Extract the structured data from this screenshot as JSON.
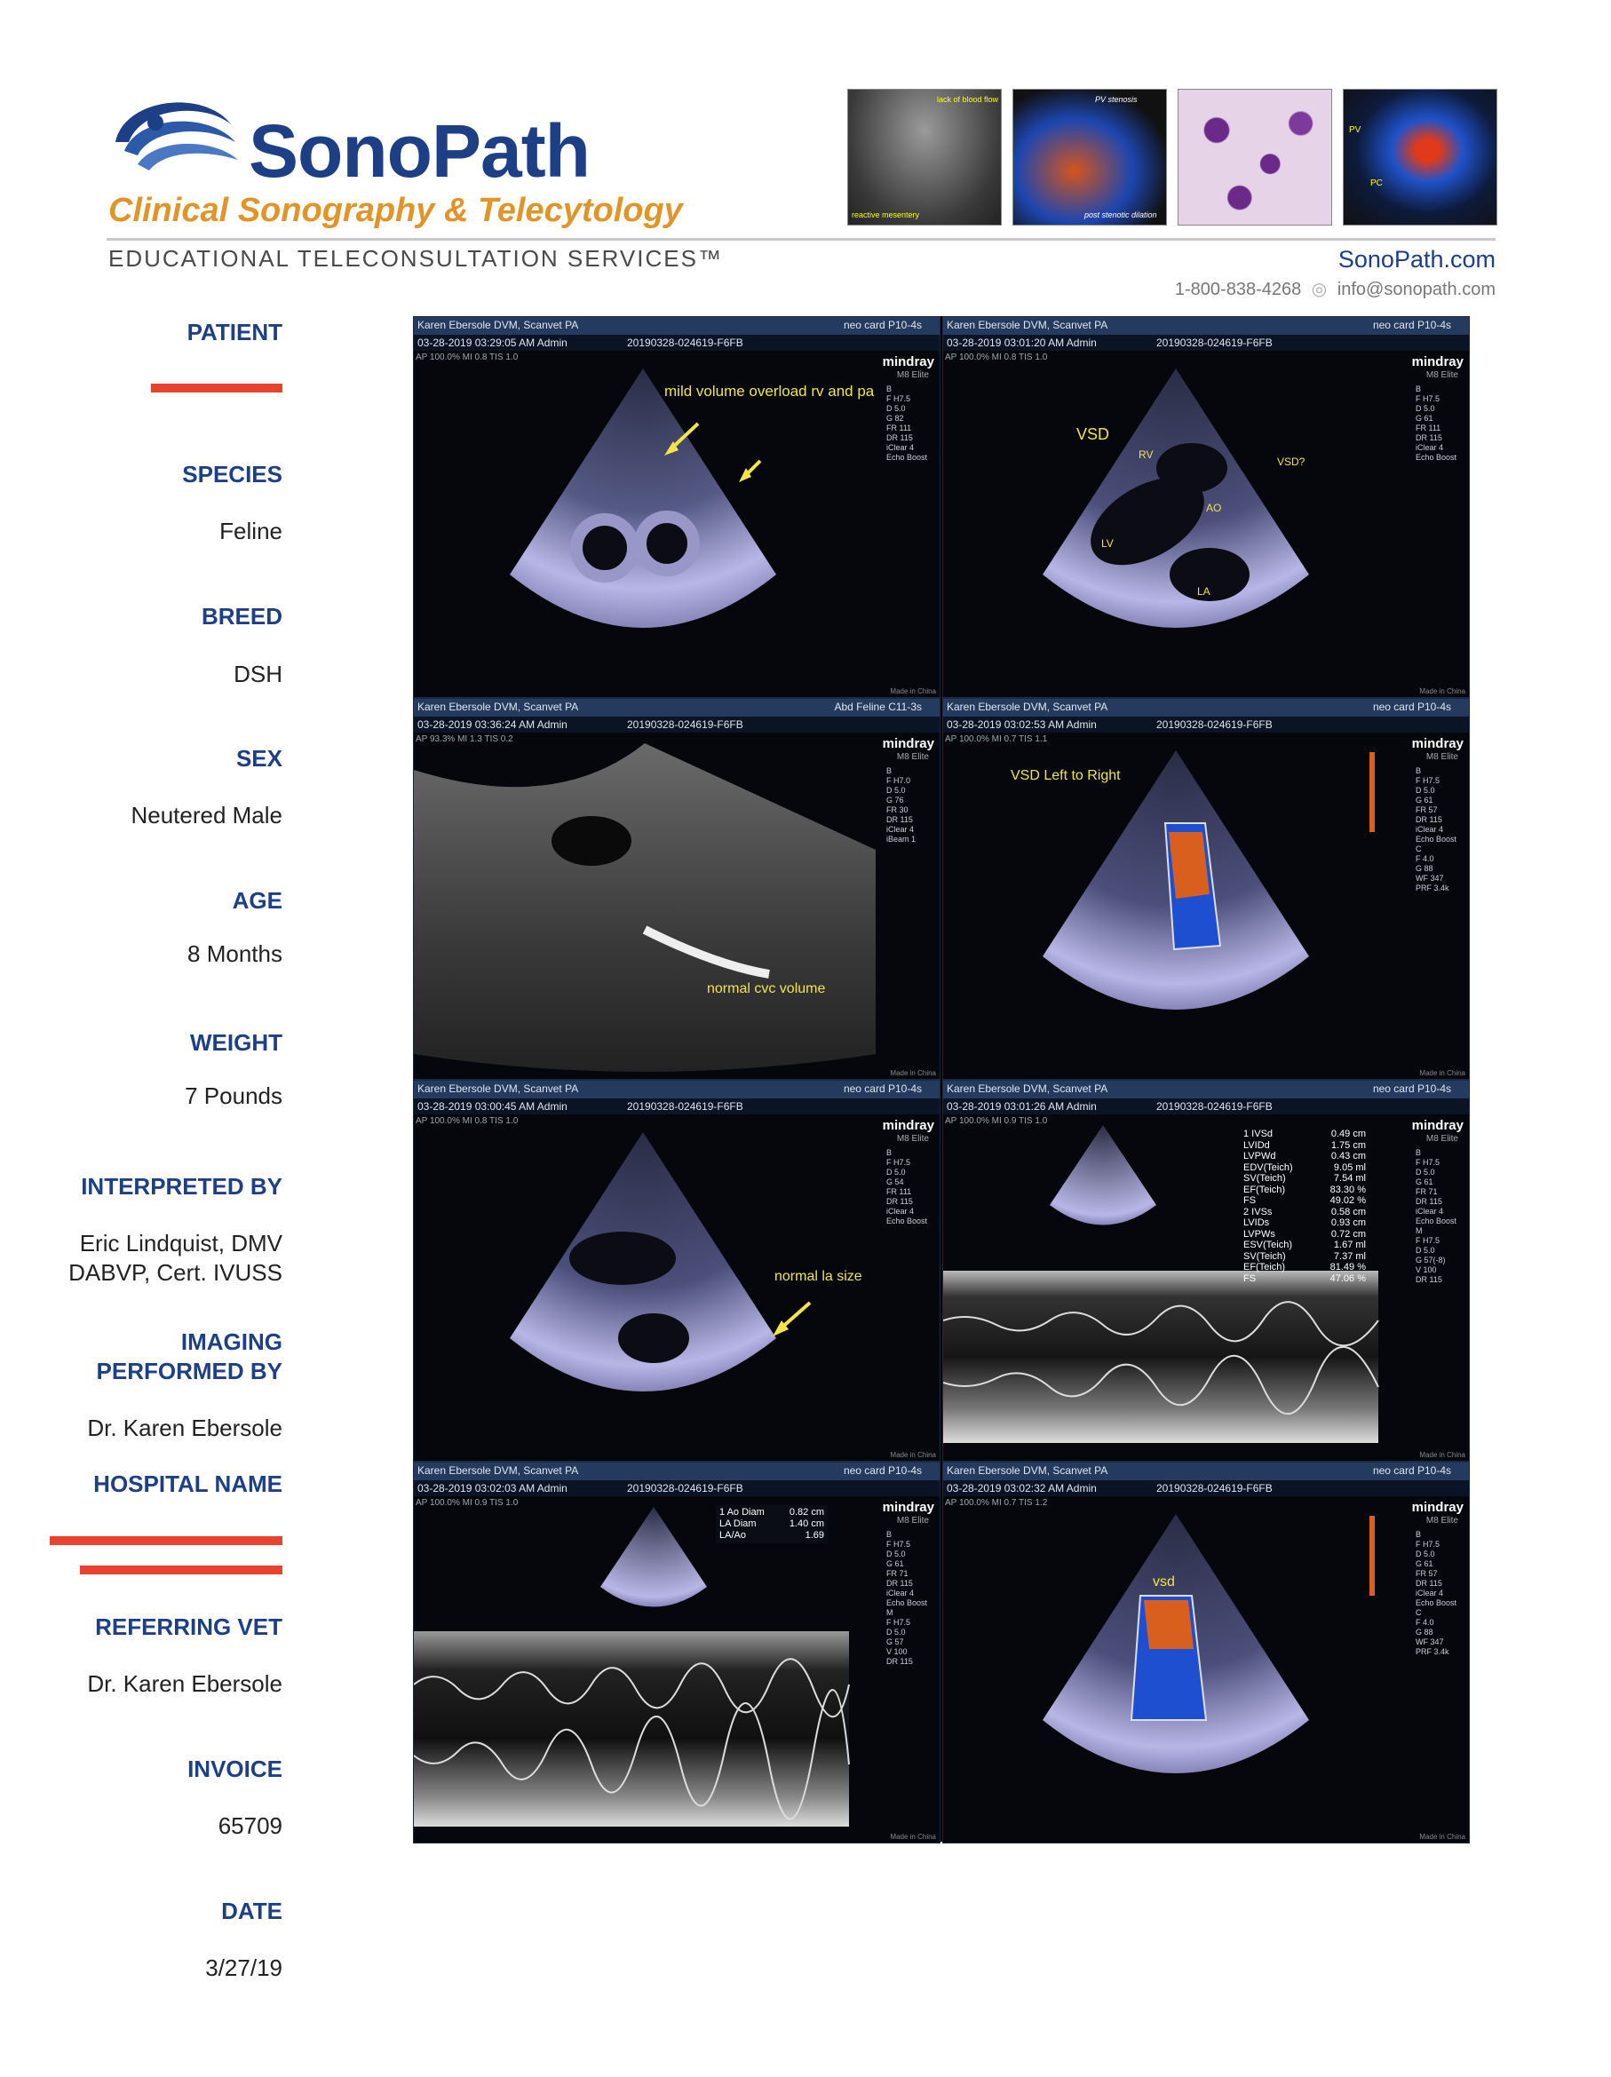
{
  "header": {
    "brand": "SonoPath",
    "tagline": "Clinical Sonography & Telecytology",
    "subtitle": "EDUCATIONAL TELECONSULTATION SERVICES™",
    "website": "SonoPath.com",
    "phone": "1-800-838-4268",
    "email": "info@sonopath.com",
    "thumb_labels": [
      "lack of blood flow",
      "reactive mesentery",
      "PV stenosis",
      "post stenotic dilation",
      "PV",
      "PC"
    ]
  },
  "fields": [
    {
      "label": "PATIENT",
      "value": "",
      "redacted": true
    },
    {
      "label": "SPECIES",
      "value": "Feline"
    },
    {
      "label": "BREED",
      "value": "DSH"
    },
    {
      "label": "SEX",
      "value": "Neutered Male"
    },
    {
      "label": "AGE",
      "value": "8 Months"
    },
    {
      "label": "WEIGHT",
      "value": "7 Pounds"
    },
    {
      "label": "INTERPRETED BY",
      "value": "Eric Lindquist, DMV",
      "value2": "DABVP, Cert. IVUSS"
    },
    {
      "label": "IMAGING",
      "label2": "PERFORMED BY",
      "value": "Dr. Karen Ebersole"
    },
    {
      "label": "HOSPITAL NAME",
      "value": "",
      "redacted": true
    },
    {
      "label": "REFERRING VET",
      "value": "Dr. Karen Ebersole"
    },
    {
      "label": "INVOICE",
      "value": "65709"
    },
    {
      "label": "DATE",
      "value": "3/27/19"
    }
  ],
  "panels": [
    {
      "clinic": "Karen Ebersole DVM, Scanvet PA",
      "datetime": "03-28-2019 03:29:05 AM Admin",
      "study_id": "20190328-024619-F6FB",
      "probe": "neo card P10-4s",
      "ap": "AP 100.0%  MI 0.8  TIS 1.0",
      "brand": "mindray",
      "model": "M8 Elite",
      "params": [
        "B",
        "F H7.5",
        "D 5.0",
        "G 82",
        "FR 111",
        "DR 115",
        "iClear 4",
        "Echo Boost"
      ],
      "annotations": [
        "mild volume overload rv and pa"
      ]
    },
    {
      "clinic": "Karen Ebersole DVM, Scanvet PA",
      "datetime": "03-28-2019 03:01:20 AM Admin",
      "study_id": "20190328-024619-F6FB",
      "probe": "neo card P10-4s",
      "ap": "AP 100.0%  MI 0.8  TIS 1.0",
      "brand": "mindray",
      "model": "M8 Elite",
      "params": [
        "B",
        "F H7.5",
        "D 5.0",
        "G 61",
        "FR 111",
        "DR 115",
        "iClear 4",
        "Echo Boost"
      ],
      "annotations": [
        "VSD",
        "RV",
        "VSD?",
        "AO",
        "LV",
        "LA"
      ]
    },
    {
      "clinic": "Karen Ebersole DVM, Scanvet PA",
      "datetime": "03-28-2019 03:36:24 AM Admin",
      "study_id": "20190328-024619-F6FB",
      "probe": "Abd Feline C11-3s",
      "ap": "AP 93.3%  MI 1.3  TIS 0.2",
      "brand": "mindray",
      "model": "M8 Elite",
      "params": [
        "B",
        "F H7.0",
        "D 5.0",
        "G 76",
        "FR 30",
        "DR 115",
        "iClear 4",
        "iBeam 1"
      ],
      "annotations": [
        "normal cvc volume"
      ]
    },
    {
      "clinic": "Karen Ebersole DVM, Scanvet PA",
      "datetime": "03-28-2019 03:02:53 AM Admin",
      "study_id": "20190328-024619-F6FB",
      "probe": "neo card P10-4s",
      "ap": "AP 100.0%  MI 0.7  TIS 1.1",
      "brand": "mindray",
      "model": "M8 Elite",
      "params": [
        "B",
        "F H7.5",
        "D 5.0",
        "G 61",
        "FR 57",
        "DR 115",
        "iClear 4",
        "Echo Boost",
        "C",
        "F 4.0",
        "G 88",
        "WF 347",
        "PRF 3.4k"
      ],
      "annotations": [
        "VSD Left to Right"
      ]
    },
    {
      "clinic": "Karen Ebersole DVM, Scanvet PA",
      "datetime": "03-28-2019 03:00:45 AM Admin",
      "study_id": "20190328-024619-F6FB",
      "probe": "neo card P10-4s",
      "ap": "AP 100.0%  MI 0.8  TIS 1.0",
      "brand": "mindray",
      "model": "M8 Elite",
      "params": [
        "B",
        "F H7.5",
        "D 5.0",
        "G 54",
        "FR 111",
        "DR 115",
        "iClear 4",
        "Echo Boost"
      ],
      "annotations": [
        "normal la size"
      ]
    },
    {
      "clinic": "Karen Ebersole DVM, Scanvet PA",
      "datetime": "03-28-2019 03:01:26 AM Admin",
      "study_id": "20190328-024619-F6FB",
      "probe": "neo card P10-4s",
      "ap": "AP 100.0%  MI 0.9  TIS 1.0",
      "brand": "mindray",
      "model": "M8 Elite",
      "params": [
        "B",
        "F H7.5",
        "D 5.0",
        "G 61",
        "FR 71",
        "DR 115",
        "iClear 4",
        "Echo Boost",
        "M",
        "F H7.5",
        "D 5.0",
        "G 57(-8)",
        "V 100",
        "DR 115"
      ],
      "annotations": [],
      "measurements": [
        [
          "1 IVSd",
          "0.49 cm"
        ],
        [
          "LVIDd",
          "1.75 cm"
        ],
        [
          "LVPWd",
          "0.43 cm"
        ],
        [
          "EDV(Teich)",
          "9.05 ml"
        ],
        [
          "SV(Teich)",
          "7.54 ml"
        ],
        [
          "EF(Teich)",
          "83.30 %"
        ],
        [
          "FS",
          "49.02 %"
        ],
        [
          "2 IVSs",
          "0.58 cm"
        ],
        [
          "LVIDs",
          "0.93 cm"
        ],
        [
          "LVPWs",
          "0.72 cm"
        ],
        [
          "ESV(Teich)",
          "1.67 ml"
        ],
        [
          "SV(Teich)",
          "7.37 ml"
        ],
        [
          "EF(Teich)",
          "81.49 %"
        ],
        [
          "FS",
          "47.06 %"
        ]
      ]
    },
    {
      "clinic": "Karen Ebersole DVM, Scanvet PA",
      "datetime": "03-28-2019 03:02:03 AM Admin",
      "study_id": "20190328-024619-F6FB",
      "probe": "neo card P10-4s",
      "ap": "AP 100.0%  MI 0.9  TIS 1.0",
      "brand": "mindray",
      "model": "M8 Elite",
      "params": [
        "B",
        "F H7.5",
        "D 5.0",
        "G 61",
        "FR 71",
        "DR 115",
        "iClear 4",
        "Echo Boost",
        "M",
        "F H7.5",
        "D 5.0",
        "G 57",
        "V 100",
        "DR 115"
      ],
      "annotations": [],
      "measurements": [
        [
          "1 Ao Diam",
          "0.82 cm"
        ],
        [
          "LA Diam",
          "1.40 cm"
        ],
        [
          "LA/Ao",
          "1.69"
        ]
      ]
    },
    {
      "clinic": "Karen Ebersole DVM, Scanvet PA",
      "datetime": "03-28-2019 03:02:32 AM Admin",
      "study_id": "20190328-024619-F6FB",
      "probe": "neo card P10-4s",
      "ap": "AP 100.0%  MI 0.7  TIS 1.2",
      "brand": "mindray",
      "model": "M8 Elite",
      "params": [
        "B",
        "F H7.5",
        "D 5.0",
        "G 61",
        "FR 57",
        "DR 115",
        "iClear 4",
        "Echo Boost",
        "C",
        "F 4.0",
        "G 88",
        "WF 347",
        "PRF 3.4k"
      ],
      "annotations": [
        "vsd"
      ]
    }
  ],
  "colors": {
    "brand_blue": "#1c3f85",
    "brand_orange": "#e0952b",
    "redaction": "#e8432f",
    "annotation": "#f2e44a"
  }
}
